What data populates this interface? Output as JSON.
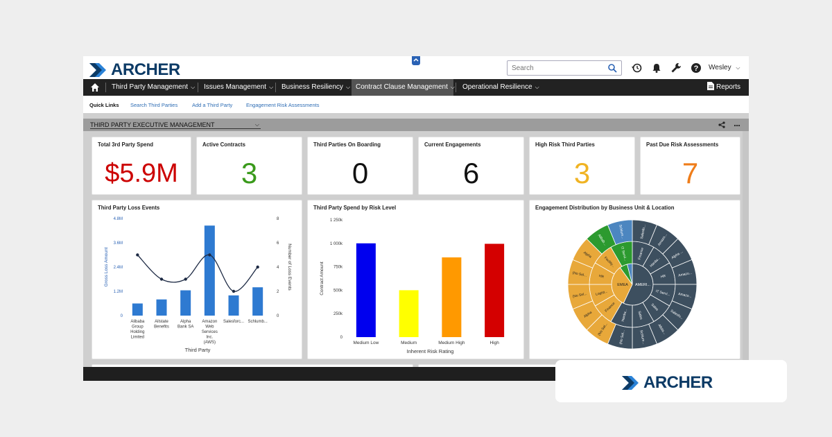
{
  "brand": {
    "name": "ARCHER",
    "colors": {
      "navy": "#0d3b66",
      "blue": "#2a82d7"
    }
  },
  "search": {
    "placeholder": "Search"
  },
  "user": {
    "name": "Wesley"
  },
  "nav": {
    "items": [
      {
        "label": "Third Party Management"
      },
      {
        "label": "Issues Management"
      },
      {
        "label": "Business Resiliency"
      },
      {
        "label": "Contract Clause Management"
      },
      {
        "label": "Operational Resilience"
      }
    ],
    "reports_label": "Reports"
  },
  "quick_links": {
    "title": "Quick Links",
    "links": [
      "Search Third Parties",
      "Add a Third Party",
      "Engagement Risk Assessments"
    ]
  },
  "dashboard": {
    "title": "THIRD PARTY EXECUTIVE MANAGEMENT"
  },
  "kpis": [
    {
      "title": "Total 3rd Party Spend",
      "value": "$5.9M",
      "color": "#cc0000"
    },
    {
      "title": "Active Contracts",
      "value": "3",
      "color": "#3a9a1b"
    },
    {
      "title": "Third Parties On Boarding",
      "value": "0",
      "color": "#111111"
    },
    {
      "title": "Current Engagements",
      "value": "6",
      "color": "#111111"
    },
    {
      "title": "High Risk Third Parties",
      "value": "3",
      "color": "#f0b323"
    },
    {
      "title": "Past Due Risk Assessments",
      "value": "7",
      "color": "#ef7d1a"
    }
  ],
  "chart_data": [
    {
      "type": "bar",
      "title": "Third Party Loss Events",
      "xlabel": "Third Party",
      "ylabel": "Gross Loss Amount",
      "y2label": "Number of Loss Events",
      "categories": [
        "Alibaba Group Holding Limited",
        "Allstate Benefits",
        "Alpha Bank SA",
        "Amazon Web Services Inc. (AWS)",
        "Salesforc...",
        "Schlumb..."
      ],
      "category_lines": [
        [
          "Alibaba",
          "Group",
          "Holding",
          "Limited"
        ],
        [
          "Allstate",
          "Benefits"
        ],
        [
          "Alpha",
          "Bank SA"
        ],
        [
          "Amazon",
          "Web",
          "Services",
          "Inc.",
          "(AWS)"
        ],
        [
          "Salesforc..."
        ],
        [
          "Schlumb..."
        ]
      ],
      "ylim": [
        0,
        4800000
      ],
      "yticks": [
        "0",
        "1.2M",
        "2.4M",
        "3.6M",
        "4.8M"
      ],
      "y2lim": [
        0,
        8
      ],
      "y2ticks": [
        "0",
        "2",
        "4",
        "6",
        "8"
      ],
      "series": [
        {
          "type": "bar",
          "values": [
            600000,
            800000,
            1250000,
            4450000,
            1000000,
            1400000
          ]
        },
        {
          "type": "line",
          "axis": "right",
          "values": [
            5,
            3,
            3,
            5,
            2,
            4
          ]
        }
      ]
    },
    {
      "type": "bar",
      "title": "Third Party Spend by Risk Level",
      "xlabel": "Inherent Risk Rating",
      "ylabel": "Contract Amount",
      "categories": [
        "Medium Low",
        "Medium",
        "Medium High",
        "High"
      ],
      "values": [
        1000000,
        500000,
        850000,
        995000
      ],
      "colors": [
        "#0000ee",
        "#ffff00",
        "#ff9900",
        "#d40000"
      ],
      "ylim": [
        0,
        1250000
      ],
      "yticks": [
        "0",
        "250k",
        "500k",
        "750k",
        "1 000k",
        "1 250k"
      ]
    },
    {
      "type": "sunburst",
      "title": "Engagement Distribution by Business Unit & Location",
      "inner": [
        {
          "label": "AMERI...",
          "share": 0.57,
          "color": "#3d4f5f"
        },
        {
          "label": "EMEA",
          "share": 0.33,
          "color": "#e8a83a"
        },
        {
          "label": "LATAM",
          "share": 0.06,
          "color": "#2c9a2f"
        },
        {
          "label": "APJ",
          "share": 0.04,
          "color": "#4c86c0"
        }
      ],
      "middle_labels": [
        "Finance",
        "Hardw...",
        "HR",
        "IT Servi...",
        "Sales",
        "Sales",
        "Hardw...",
        "Finance",
        "Logist...",
        "HR",
        "Facility...",
        "IT Servi..."
      ],
      "outer_labels": [
        "Salesfo...",
        "Amazo...",
        "Alpha ...",
        "Amazo...",
        "Amazo...",
        "Salesfo...",
        "Allsta...",
        "Schlum...",
        "(No Sel...",
        "(No Sel...",
        "Alpha",
        "(No Sel...",
        "(No Sel...",
        "Alpha",
        "Alibab...",
        "Schlum..."
      ]
    }
  ]
}
